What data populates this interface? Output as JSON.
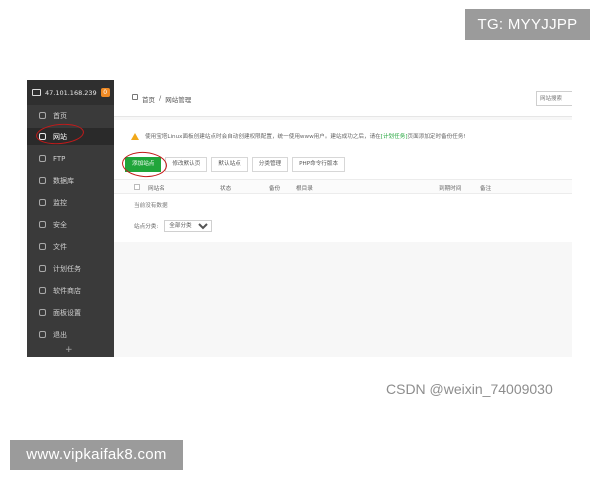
{
  "watermarks": {
    "tg": "TG: MYYJJPP",
    "site": "www.vipkaifak8.com",
    "csdn": "CSDN @weixin_74009030"
  },
  "sidebar": {
    "server_ip": "47.101.168.239",
    "items": [
      {
        "label": "首页",
        "icon": "home-icon"
      },
      {
        "label": "网站",
        "icon": "globe-icon",
        "active": true
      },
      {
        "label": "FTP",
        "icon": "ftp-icon"
      },
      {
        "label": "数据库",
        "icon": "database-icon"
      },
      {
        "label": "监控",
        "icon": "monitor-icon"
      },
      {
        "label": "安全",
        "icon": "shield-icon"
      },
      {
        "label": "文件",
        "icon": "folder-icon"
      },
      {
        "label": "计划任务",
        "icon": "schedule-icon"
      },
      {
        "label": "软件商店",
        "icon": "store-icon"
      },
      {
        "label": "面板设置",
        "icon": "gear-icon"
      },
      {
        "label": "退出",
        "icon": "logout-icon"
      }
    ],
    "add_symbol": "+"
  },
  "breadcrumb": {
    "home": "首页",
    "separator": "/",
    "current": "网站管理"
  },
  "search": {
    "placeholder": "网站搜索"
  },
  "notice": {
    "text_before": "使用宝塔Linux面板创建站点时会自动创建权限配置，统一使用www用户。建站成功之后，请在",
    "link": "[计划任务]",
    "text_after": "页面添加定时备份任务!"
  },
  "toolbar": {
    "add_site": "添加站点",
    "change_default_page": "修改默认页",
    "default_site": "默认站点",
    "category_manage": "分类管理",
    "php_cli_version": "PHP命令行版本"
  },
  "table": {
    "columns": [
      "网站名",
      "状态",
      "备份",
      "根目录",
      "到期时间",
      "备注"
    ],
    "empty_text": "当前没有数据"
  },
  "filter": {
    "label": "站点分类:",
    "selected": "全部分类"
  },
  "colors": {
    "sidebar_bg": "#3a3a3a",
    "accent_green": "#20a53a",
    "warning": "#f1a81a",
    "markup_red": "#c41a1a",
    "badge_gray": "#9b9b9b"
  }
}
